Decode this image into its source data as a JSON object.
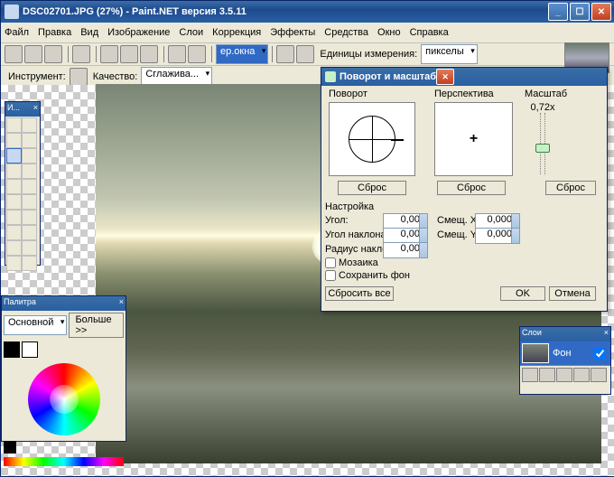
{
  "title": "DSC02701.JPG (27%) - Paint.NET версия 3.5.11",
  "menu": [
    "Файл",
    "Правка",
    "Вид",
    "Изображение",
    "Слои",
    "Коррекция",
    "Эффекты",
    "Средства",
    "Окно",
    "Справка"
  ],
  "toolbar1": {
    "unit_label": "Единицы измерения:",
    "unit_value": "пикселы",
    "fit_label": "ер.окна"
  },
  "toolbar2": {
    "instrument": "Инструмент:",
    "quality": "Качество:",
    "quality_value": "Сглажива..."
  },
  "toolbox": {
    "title": "И..."
  },
  "palette": {
    "title": "Палитра",
    "primary_label": "Основной",
    "more": "Больше >>"
  },
  "layers": {
    "title": "Слои",
    "bg": "Фон"
  },
  "dialog": {
    "title": "Поворот и масштаб",
    "rotation": "Поворот",
    "perspective": "Перспектива",
    "scale": "Масштаб",
    "reset": "Сброс",
    "tuning": "Настройка",
    "angle": "Угол:",
    "tilt_angle": "Угол наклона:",
    "tilt_radius": "Радиус наклона",
    "offset_x": "Смещ. X:",
    "offset_y": "Смещ. Y:",
    "mosaic": "Мозаика",
    "keep_bg": "Сохранить фон",
    "reset_all": "Сбросить все",
    "ok": "OK",
    "cancel": "Отмена",
    "zoom_val": "0,72x",
    "val_angle": "0,00",
    "val_tilt_angle": "0,00",
    "val_tilt_radius": "0,00",
    "val_off_x": "0,000",
    "val_off_y": "0,000"
  }
}
